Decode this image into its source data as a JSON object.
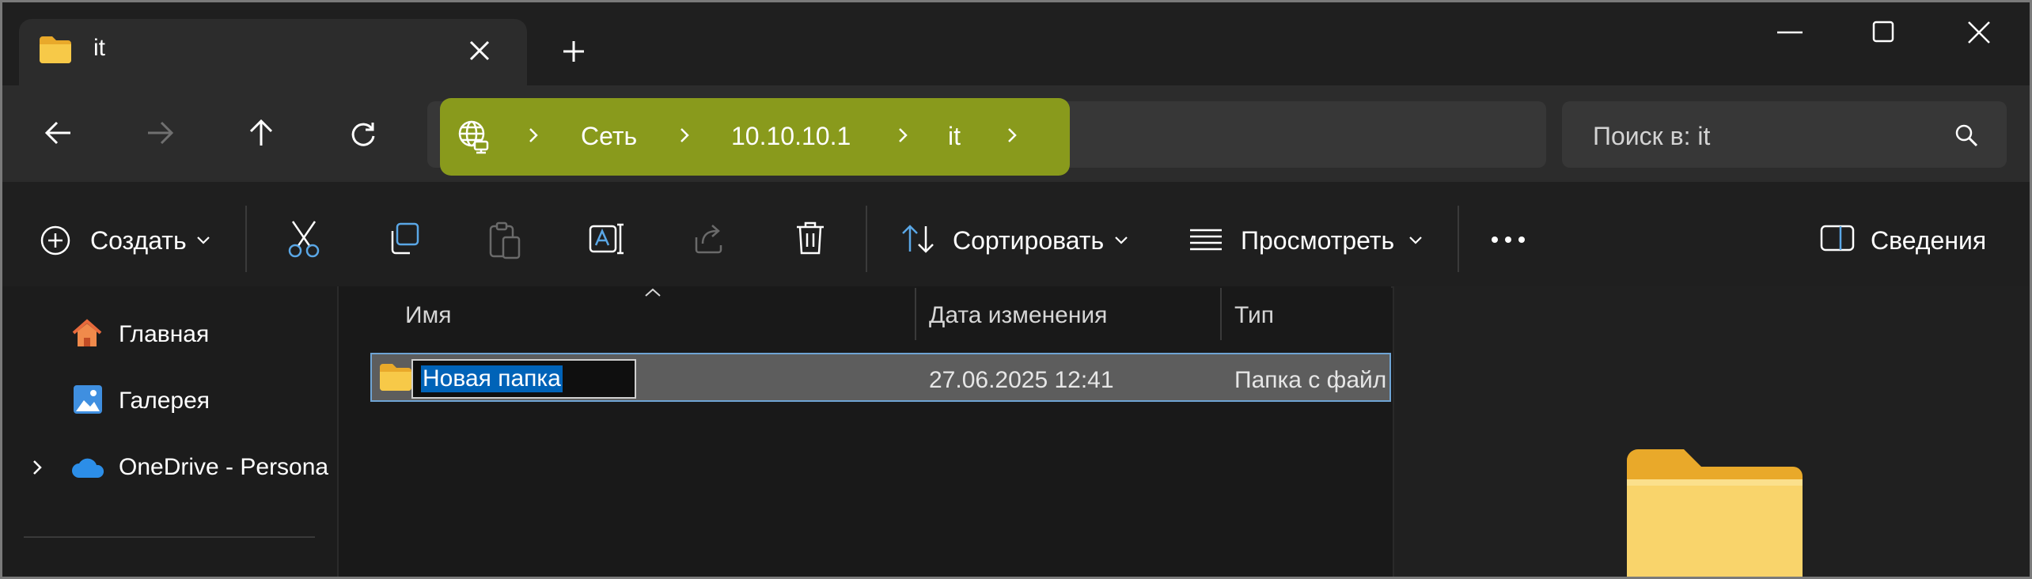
{
  "tab": {
    "title": "it",
    "icon": "folder-icon",
    "close_icon": "close-icon",
    "new_tab_icon": "plus-icon"
  },
  "window_controls": {
    "minimize_icon": "minimize-icon",
    "maximize_icon": "maximize-icon",
    "close_icon": "close-icon"
  },
  "nav": {
    "back_icon": "arrow-left-icon",
    "forward_icon": "arrow-right-icon",
    "up_icon": "arrow-up-icon",
    "refresh_icon": "refresh-icon"
  },
  "breadcrumb": {
    "root_icon": "network-globe-icon",
    "items": [
      "Сеть",
      "10.10.10.1",
      "it"
    ],
    "highlight_color": "#899a1c"
  },
  "search": {
    "placeholder": "Поиск в: it",
    "icon": "search-icon"
  },
  "toolbar": {
    "create_label": "Создать",
    "sort_label": "Сортировать",
    "view_label": "Просмотреть",
    "details_label": "Сведения",
    "icons": [
      "plus-circle-icon",
      "cut-icon",
      "copy-icon",
      "paste-icon",
      "rename-icon",
      "share-icon",
      "delete-icon",
      "sort-icon",
      "view-icon",
      "more-icon",
      "details-pane-icon"
    ]
  },
  "sidebar": {
    "items": [
      {
        "label": "Главная",
        "icon": "home-icon"
      },
      {
        "label": "Галерея",
        "icon": "gallery-icon"
      },
      {
        "label": "OneDrive - Persona",
        "icon": "cloud-icon",
        "expandable": true
      }
    ]
  },
  "columns": {
    "name": "Имя",
    "modified": "Дата изменения",
    "type": "Тип"
  },
  "files": [
    {
      "name": "Новая папка",
      "modified": "27.06.2025 12:41",
      "type": "Папка с файл",
      "selected": true,
      "renaming": true
    }
  ],
  "colors": {
    "accent": "#0063b8",
    "folder": "#f7c948",
    "selection_border": "#6fa4d4"
  }
}
